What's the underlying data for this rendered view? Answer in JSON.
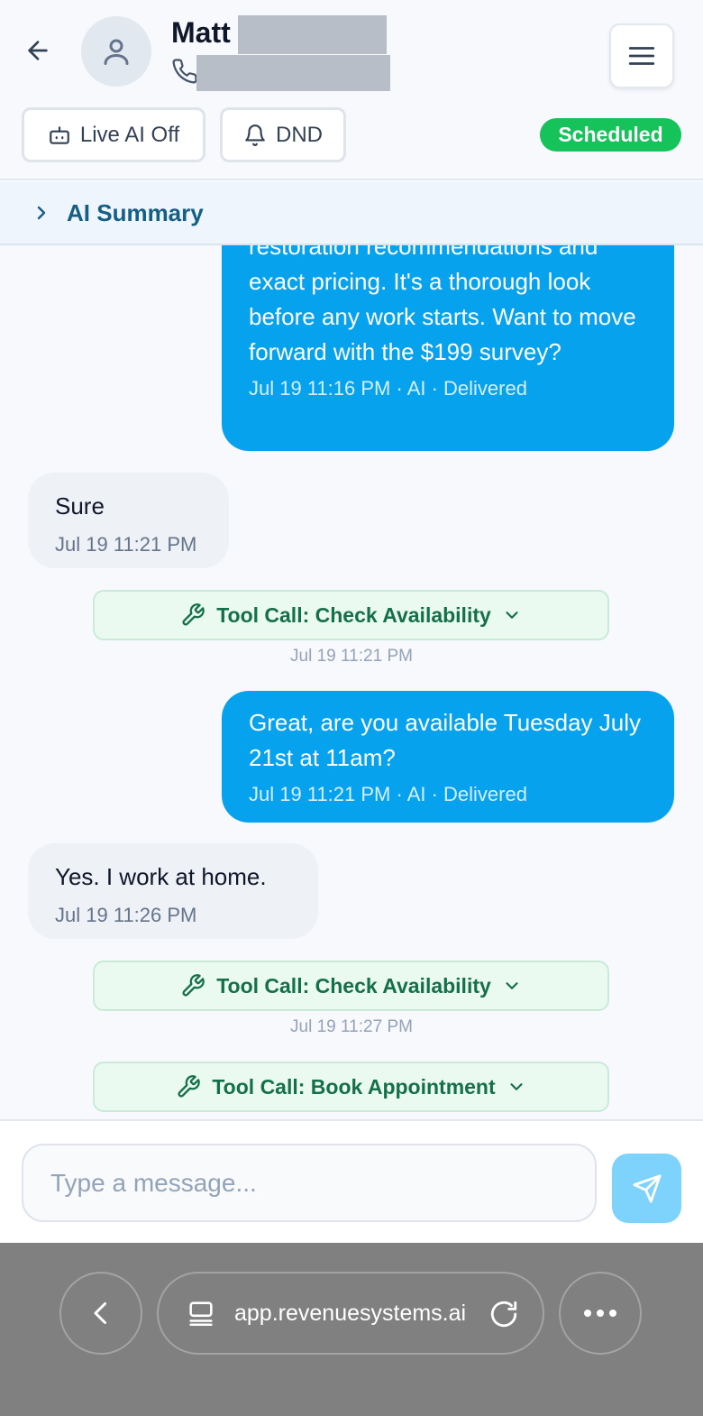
{
  "header": {
    "contact_name": "Matt",
    "live_ai_label": "Live AI Off",
    "dnd_label": "DND",
    "status": "Scheduled"
  },
  "summary": {
    "label": "AI Summary"
  },
  "messages": [
    {
      "direction": "out",
      "text": "restoration recommendations and exact pricing. It's a thorough look before any work starts. Want to move forward with the $199 survey?",
      "meta": "Jul 19 11:16 PM · AI · Delivered"
    },
    {
      "direction": "in",
      "text": "Sure",
      "meta": "Jul 19 11:21 PM"
    },
    {
      "type": "tool",
      "label": "Tool Call: Check Availability",
      "time": "Jul 19 11:21 PM"
    },
    {
      "direction": "out",
      "text": "Great, are you available Tuesday July 21st at 11am?",
      "meta": "Jul 19 11:21 PM · AI · Delivered"
    },
    {
      "direction": "in",
      "text": "Yes. I work at home.",
      "meta": "Jul 19 11:26 PM"
    },
    {
      "type": "tool",
      "label": "Tool Call: Check Availability",
      "time": "Jul 19 11:27 PM"
    },
    {
      "type": "tool",
      "label": "Tool Call: Book Appointment",
      "time": ""
    }
  ],
  "composer": {
    "placeholder": "Type a message..."
  },
  "browser": {
    "url": "app.revenuesystems.ai"
  },
  "colors": {
    "outgoing_bubble": "#06a2ee",
    "incoming_bubble": "#eef1f6",
    "status_badge": "#16c25a",
    "tool_call_bg": "#ebfaf1",
    "send_button": "#7dd3fc"
  }
}
